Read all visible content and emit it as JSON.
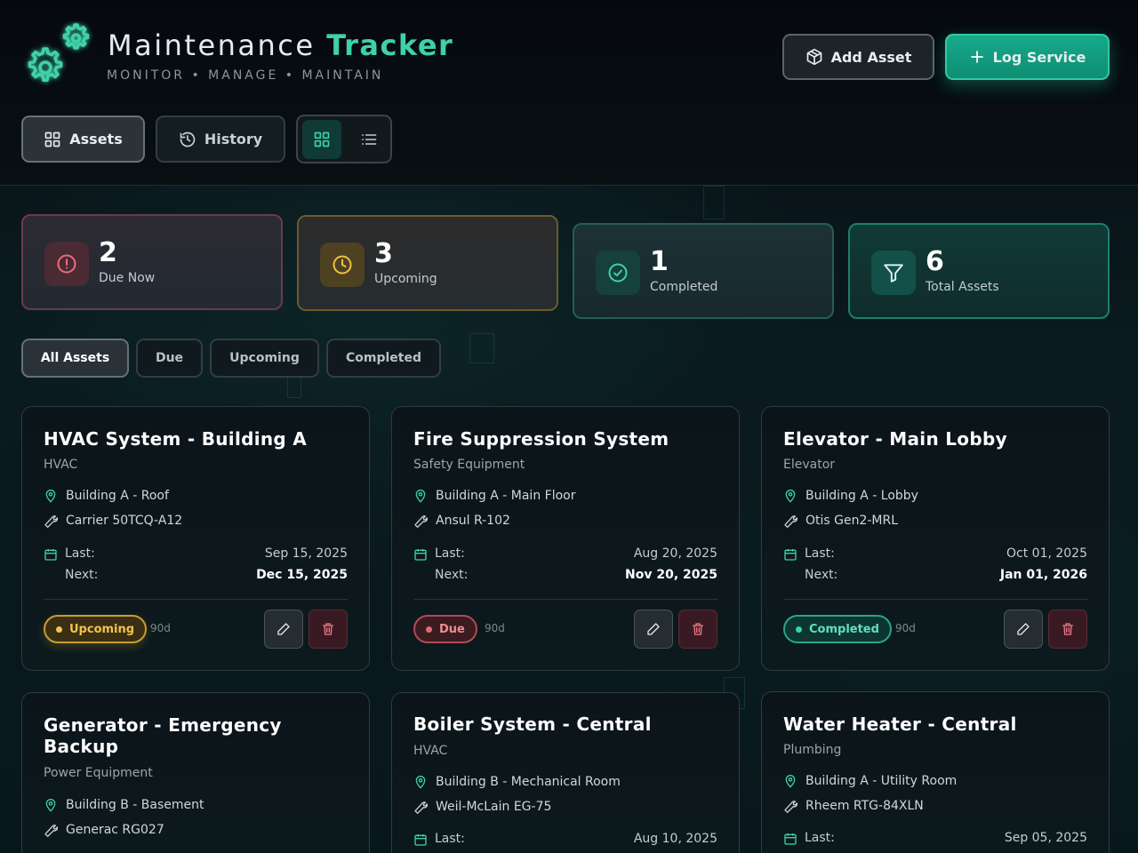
{
  "header": {
    "title_main": "Maintenance",
    "title_accent": "Tracker",
    "subtitle": "MONITOR • MANAGE • MAINTAIN",
    "add_asset_label": "Add Asset",
    "log_service_label": "Log Service"
  },
  "tabs": {
    "assets_label": "Assets",
    "history_label": "History",
    "active_view": "grid"
  },
  "stats": {
    "due_now": {
      "value": "2",
      "label": "Due Now"
    },
    "upcoming": {
      "value": "3",
      "label": "Upcoming"
    },
    "completed": {
      "value": "1",
      "label": "Completed"
    },
    "total": {
      "value": "6",
      "label": "Total Assets"
    }
  },
  "filters": [
    "All Assets",
    "Due",
    "Upcoming",
    "Completed"
  ],
  "active_filter": "All Assets",
  "colors": {
    "accent": "#3fd1a8",
    "due": "#e06a75",
    "upcoming": "#f3c44a",
    "completed": "#3fd1a8"
  },
  "labels": {
    "last": "Last:",
    "next": "Next:"
  },
  "assets": [
    {
      "name": "HVAC System - Building A",
      "category": "HVAC",
      "location": "Building A - Roof",
      "model": "Carrier 50TCQ-A12",
      "last": "Sep 15, 2025",
      "next": "Dec 15, 2025",
      "status": "Upcoming",
      "interval": "90d"
    },
    {
      "name": "Fire Suppression System",
      "category": "Safety Equipment",
      "location": "Building A - Main Floor",
      "model": "Ansul R-102",
      "last": "Aug 20, 2025",
      "next": "Nov 20, 2025",
      "status": "Due",
      "interval": "90d"
    },
    {
      "name": "Elevator - Main Lobby",
      "category": "Elevator",
      "location": "Building A - Lobby",
      "model": "Otis Gen2-MRL",
      "last": "Oct 01, 2025",
      "next": "Jan 01, 2026",
      "status": "Completed",
      "interval": "90d"
    },
    {
      "name": "Generator - Emergency Backup",
      "category": "Power Equipment",
      "location": "Building B - Basement",
      "model": "Generac RG027"
    },
    {
      "name": "Boiler System - Central",
      "category": "HVAC",
      "location": "Building B - Mechanical Room",
      "model": "Weil-McLain EG-75",
      "last": "Aug 10, 2025"
    },
    {
      "name": "Water Heater - Central",
      "category": "Plumbing",
      "location": "Building A - Utility Room",
      "model": "Rheem RTG-84XLN",
      "last": "Sep 05, 2025"
    }
  ]
}
